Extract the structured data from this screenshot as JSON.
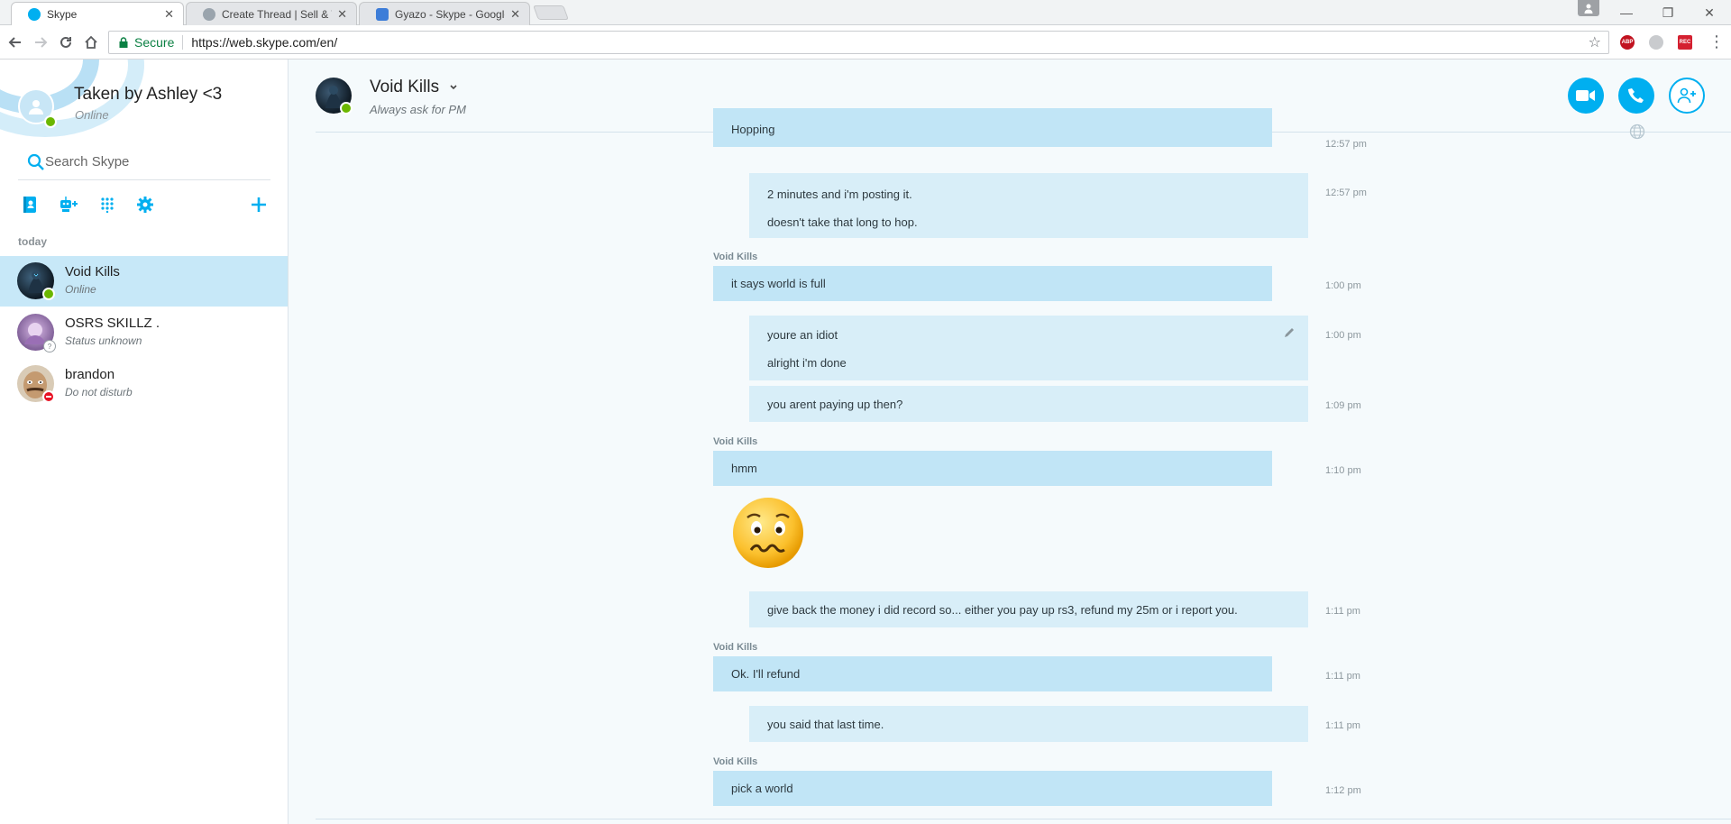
{
  "browser": {
    "tabs": [
      {
        "title": "Skype",
        "active": true
      },
      {
        "title": "Create Thread | Sell & Tr",
        "active": false
      },
      {
        "title": "Gyazo - Skype - Google",
        "active": false
      }
    ],
    "secure_label": "Secure",
    "url": "https://web.skype.com/en/",
    "extensions": [
      "ABP",
      "",
      "REC"
    ]
  },
  "sidebar": {
    "profile_name": "Taken by Ashley <3",
    "profile_status": "Online",
    "search_placeholder": "Search Skype",
    "section_label": "today",
    "contacts": [
      {
        "name": "Void Kills",
        "status": "Online",
        "presence": "online",
        "selected": true
      },
      {
        "name": "OSRS SKILLZ .",
        "status": "Status unknown",
        "presence": "unknown",
        "selected": false
      },
      {
        "name": "brandon",
        "status": "Do not disturb",
        "presence": "dnd",
        "selected": false
      }
    ]
  },
  "conversation": {
    "title": "Void Kills",
    "subtitle": "Always ask for PM",
    "messages": [
      {
        "dir": "in",
        "lines": [
          "Hopping"
        ],
        "time": "12:57 pm"
      },
      {
        "dir": "out",
        "lines": [
          "2 minutes and i'm posting it.",
          "doesn't take that long to hop."
        ],
        "time": "12:57 pm"
      },
      {
        "dir": "in",
        "sender": "Void Kills",
        "lines": [
          "it says world is full"
        ],
        "time": "1:00 pm"
      },
      {
        "dir": "out",
        "lines": [
          "youre an idiot",
          "alright i'm done"
        ],
        "time": "1:00 pm",
        "edited": true
      },
      {
        "dir": "out",
        "lines": [
          "you arent paying up then?"
        ],
        "time": "1:09 pm"
      },
      {
        "dir": "in",
        "sender": "Void Kills",
        "lines": [
          "hmm"
        ],
        "time": "1:10 pm"
      },
      {
        "dir": "in",
        "emoticon": "worried-emoticon"
      },
      {
        "dir": "out",
        "lines": [
          "give back the money i did record so... either you pay up rs3, refund my 25m or i report you."
        ],
        "time": "1:11 pm"
      },
      {
        "dir": "in",
        "sender": "Void Kills",
        "lines": [
          "Ok. I'll refund"
        ],
        "time": "1:11 pm"
      },
      {
        "dir": "out",
        "lines": [
          "you said that last time."
        ],
        "time": "1:11 pm"
      },
      {
        "dir": "in",
        "sender": "Void Kills",
        "lines": [
          "pick a world"
        ],
        "time": "1:12 pm"
      }
    ]
  },
  "colors": {
    "accent": "#00aff0",
    "incoming_bubble": "#c1e5f6",
    "outgoing_bubble": "#d8eef8",
    "online": "#6bb700",
    "dnd": "#e81123"
  }
}
